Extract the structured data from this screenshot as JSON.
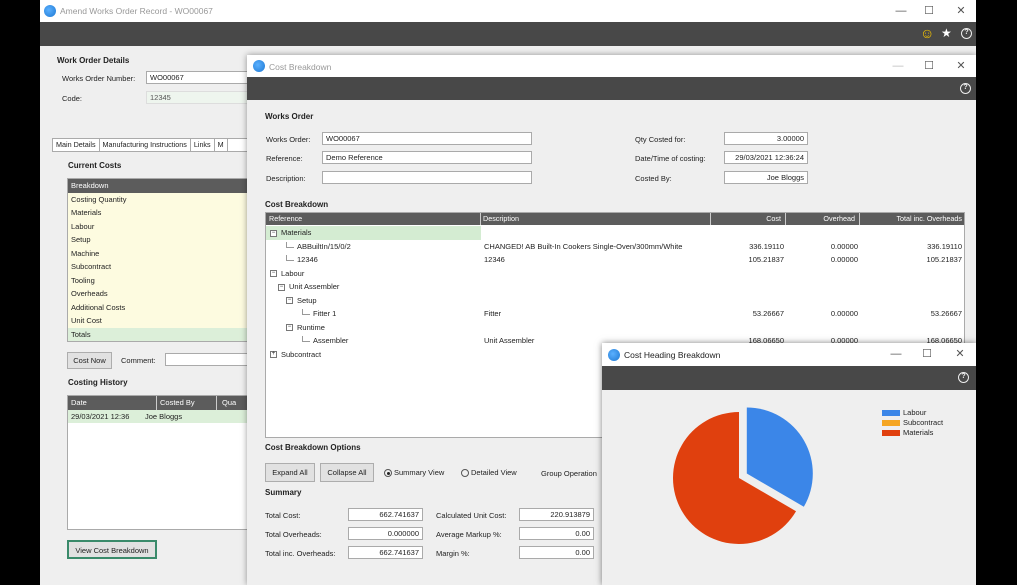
{
  "main_window": {
    "title": "Amend Works Order Record - WO00067",
    "controls": {
      "minimize": "—",
      "maximize": "☐",
      "close": "✕"
    },
    "toolbar": {
      "smiley": "☺",
      "star": "★",
      "help": "?"
    },
    "wo_details": {
      "header": "Work Order Details",
      "number_label": "Works Order Number:",
      "number_value": "WO00067",
      "code_label": "Code:",
      "code_value": "12345"
    },
    "tabs": [
      "Main Details",
      "Manufacturing Instructions",
      "Links",
      "M"
    ],
    "current_costs": {
      "header": "Current Costs",
      "rows": [
        {
          "label": "Breakdown",
          "style": "hd"
        },
        {
          "label": "Costing Quantity",
          "style": "y"
        },
        {
          "label": "Materials",
          "style": "y"
        },
        {
          "label": "Labour",
          "style": "y"
        },
        {
          "label": "Setup",
          "style": "y"
        },
        {
          "label": "Machine",
          "style": "y"
        },
        {
          "label": "Subcontract",
          "style": "y"
        },
        {
          "label": "Tooling",
          "style": "y"
        },
        {
          "label": "Overheads",
          "style": "y"
        },
        {
          "label": "Additional Costs",
          "style": "y"
        },
        {
          "label": "Unit Cost",
          "style": "y"
        },
        {
          "label": "Totals",
          "style": "g"
        }
      ]
    },
    "cost_now_label": "Cost Now",
    "comment_label": "Comment:",
    "comment_value": "",
    "costing_history": {
      "header": "Costing History",
      "columns": [
        "Date",
        "Costed By",
        "Qua"
      ],
      "rows": [
        [
          "29/03/2021 12:36",
          "Joe Bloggs",
          ""
        ]
      ]
    },
    "view_button": "View Cost Breakdown"
  },
  "cost_breakdown": {
    "title": "Cost Breakdown",
    "controls": {
      "minimize": "—",
      "maximize": "☐",
      "close": "✕"
    },
    "help": "?",
    "works_order_header": "Works Order",
    "fields": {
      "works_order_label": "Works Order:",
      "works_order_value": "WO00067",
      "reference_label": "Reference:",
      "reference_value": "Demo Reference",
      "description_label": "Description:",
      "description_value": "",
      "qty_label": "Qty Costed for:",
      "qty_value": "3.00000",
      "datetime_label": "Date/Time of costing:",
      "datetime_value": "29/03/2021 12:36:24",
      "costed_by_label": "Costed By:",
      "costed_by_value": "Joe Bloggs"
    },
    "grid_header": "Cost Breakdown",
    "grid_columns": [
      "Reference",
      "Description",
      "Cost",
      "Overhead",
      "Total inc. Overheads"
    ],
    "grid_rows": [
      {
        "ref": "Materials",
        "toggle": "−",
        "indent": 0,
        "desc": "",
        "cost": "",
        "overhead": "",
        "total": "",
        "hl": true
      },
      {
        "ref": "ABBuiltIn/15/0/2",
        "toggle": "",
        "indent": 2,
        "desc": "CHANGED! AB Built-In Cookers Single-Oven/300mm/White",
        "cost": "336.19110",
        "overhead": "0.00000",
        "total": "336.19110"
      },
      {
        "ref": "12346",
        "toggle": "",
        "indent": 2,
        "desc": "12346",
        "cost": "105.21837",
        "overhead": "0.00000",
        "total": "105.21837"
      },
      {
        "ref": "Labour",
        "toggle": "−",
        "indent": 0,
        "desc": "",
        "cost": "",
        "overhead": "",
        "total": ""
      },
      {
        "ref": "Unit Assembler",
        "toggle": "−",
        "indent": 1,
        "desc": "",
        "cost": "",
        "overhead": "",
        "total": ""
      },
      {
        "ref": "Setup",
        "toggle": "−",
        "indent": 2,
        "desc": "",
        "cost": "",
        "overhead": "",
        "total": ""
      },
      {
        "ref": "Fitter 1",
        "toggle": "",
        "indent": 4,
        "desc": "Fitter",
        "cost": "53.26667",
        "overhead": "0.00000",
        "total": "53.26667"
      },
      {
        "ref": "Runtime",
        "toggle": "−",
        "indent": 2,
        "desc": "",
        "cost": "",
        "overhead": "",
        "total": ""
      },
      {
        "ref": "Assembler",
        "toggle": "",
        "indent": 4,
        "desc": "Unit Assembler",
        "cost": "168.06650",
        "overhead": "0.00000",
        "total": "168.06650"
      },
      {
        "ref": "Subcontract",
        "toggle": "+",
        "indent": 0,
        "desc": "",
        "cost": "",
        "overhead": "",
        "total": ""
      }
    ],
    "options_header": "Cost Breakdown Options",
    "expand_all": "Expand All",
    "collapse_all": "Collapse All",
    "summary_view": "Summary View",
    "detailed_view": "Detailed View",
    "group_operation": "Group Operation",
    "summary_header": "Summary",
    "summary": {
      "total_cost_label": "Total Cost:",
      "total_cost_value": "662.741637",
      "total_overheads_label": "Total Overheads:",
      "total_overheads_value": "0.000000",
      "total_inc_label": "Total inc. Overheads:",
      "total_inc_value": "662.741637",
      "calc_unit_label": "Calculated Unit Cost:",
      "calc_unit_value": "220.913879",
      "avg_markup_label": "Average Markup %:",
      "avg_markup_value": "0.00",
      "margin_label": "Margin %:",
      "margin_value": "0.00"
    }
  },
  "heading_breakdown": {
    "title": "Cost Heading Breakdown",
    "controls": {
      "minimize": "—",
      "maximize": "☐",
      "close": "✕"
    },
    "help": "?",
    "chart_data": {
      "type": "pie",
      "series": [
        {
          "name": "Labour",
          "value": 221.33,
          "color": "#3b86e8"
        },
        {
          "name": "Subcontract",
          "value": 0,
          "color": "#f5a623"
        },
        {
          "name": "Materials",
          "value": 441.41,
          "color": "#e0400e"
        }
      ],
      "exploded": "Labour",
      "legend_position": "top-right"
    }
  }
}
